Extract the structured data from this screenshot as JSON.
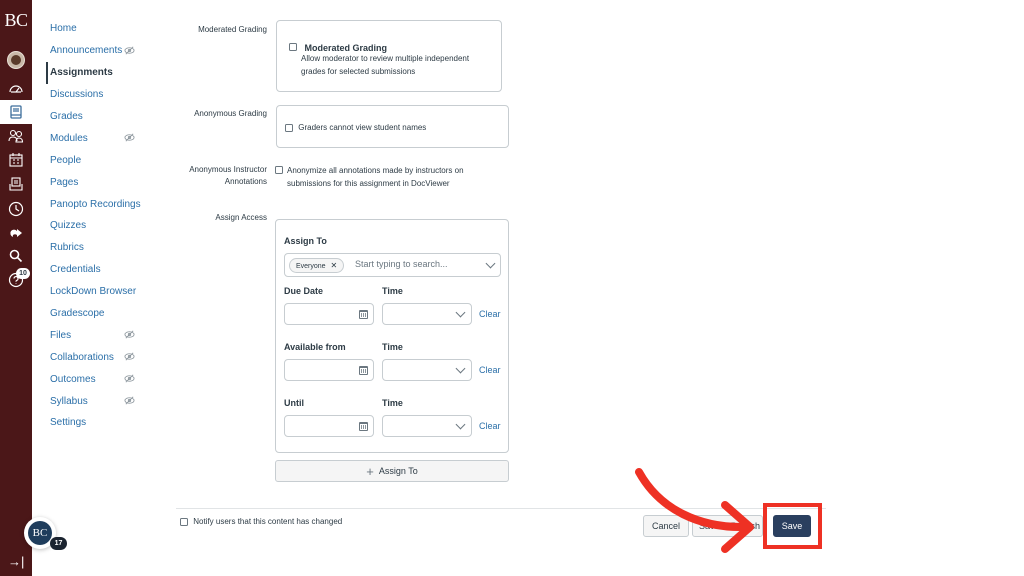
{
  "global_nav": {
    "logo_text": "BC",
    "items": [
      {
        "name": "account",
        "icon": "avatar-icon"
      },
      {
        "name": "dashboard",
        "icon": "dashboard-icon"
      },
      {
        "name": "courses",
        "icon": "courses-icon",
        "active": true
      },
      {
        "name": "groups",
        "icon": "groups-icon"
      },
      {
        "name": "calendar",
        "icon": "calendar-icon"
      },
      {
        "name": "inbox",
        "icon": "inbox-icon"
      },
      {
        "name": "history",
        "icon": "clock-icon"
      },
      {
        "name": "commons",
        "icon": "share-icon"
      },
      {
        "name": "search",
        "icon": "search-icon"
      },
      {
        "name": "help",
        "icon": "help-icon",
        "badge": "10"
      }
    ],
    "help_badge": "10",
    "collapse_icon": "collapse-nav-icon",
    "brand_color": "#4b1718"
  },
  "floating_avatar": {
    "text": "BC",
    "badge": "17"
  },
  "course_nav": {
    "items": [
      {
        "label": "Home",
        "hidden": false
      },
      {
        "label": "Announcements",
        "hidden": true
      },
      {
        "label": "Assignments",
        "hidden": false,
        "active": true
      },
      {
        "label": "Discussions",
        "hidden": false
      },
      {
        "label": "Grades",
        "hidden": false
      },
      {
        "label": "Modules",
        "hidden": true
      },
      {
        "label": "People",
        "hidden": false
      },
      {
        "label": "Pages",
        "hidden": false
      },
      {
        "label": "Panopto Recordings",
        "hidden": false
      },
      {
        "label": "Quizzes",
        "hidden": false
      },
      {
        "label": "Rubrics",
        "hidden": false
      },
      {
        "label": "Credentials",
        "hidden": false
      },
      {
        "label": "LockDown Browser",
        "hidden": false
      },
      {
        "label": "Gradescope",
        "hidden": false
      },
      {
        "label": "Files",
        "hidden": true
      },
      {
        "label": "Collaborations",
        "hidden": true
      },
      {
        "label": "Outcomes",
        "hidden": true
      },
      {
        "label": "Syllabus",
        "hidden": true
      },
      {
        "label": "Settings",
        "hidden": false
      }
    ]
  },
  "form": {
    "moderated_grading": {
      "label": "Moderated Grading",
      "checkbox_label": "Moderated Grading",
      "description": "Allow moderator to review multiple independent grades for selected submissions",
      "checked": false
    },
    "anonymous_grading": {
      "label": "Anonymous Grading",
      "checkbox_label": "Graders cannot view student names",
      "checked": false
    },
    "anonymous_annotations": {
      "label_line1": "Anonymous Instructor",
      "label_line2": "Annotations",
      "checkbox_line1": "Anonymize all annotations made by instructors on",
      "checkbox_line2": "submissions for this assignment in DocViewer",
      "checked": false
    },
    "assign_access": {
      "label": "Assign Access",
      "assign_to_label": "Assign To",
      "assign_to_tag": "Everyone",
      "assign_to_placeholder": "Start typing to search...",
      "due_date_label": "Due Date",
      "due_date_value": "",
      "available_from_label": "Available from",
      "available_from_value": "",
      "until_label": "Until",
      "until_value": "",
      "time_label": "Time",
      "time_value": "",
      "clear_label": "Clear",
      "add_button_label": "Assign To"
    }
  },
  "footer": {
    "notify_label": "Notify users that this content has changed",
    "notify_checked": false,
    "cancel_label": "Cancel",
    "save_publish_label": "Save & Publish",
    "save_label": "Save"
  },
  "annotation": {
    "color": "#ee3124",
    "target": "Save"
  }
}
